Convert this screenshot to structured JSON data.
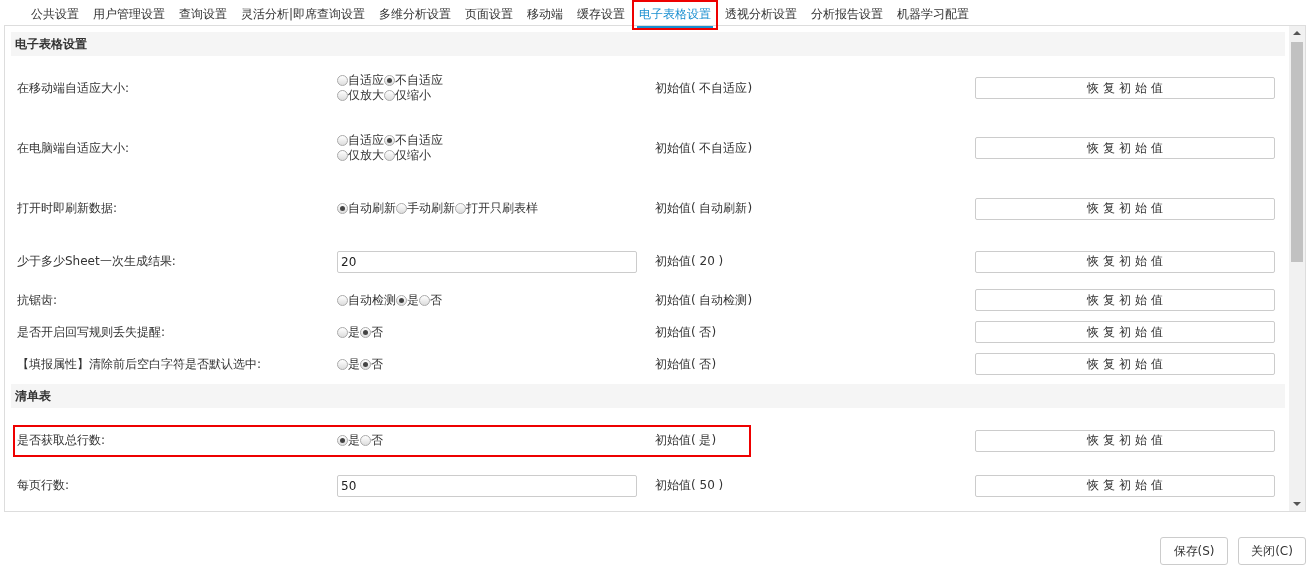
{
  "tabs": [
    {
      "label": "公共设置",
      "selected": false,
      "highlighted": false
    },
    {
      "label": "用户管理设置",
      "selected": false,
      "highlighted": false
    },
    {
      "label": "查询设置",
      "selected": false,
      "highlighted": false
    },
    {
      "label": "灵活分析|即席查询设置",
      "selected": false,
      "highlighted": false
    },
    {
      "label": "多维分析设置",
      "selected": false,
      "highlighted": false
    },
    {
      "label": "页面设置",
      "selected": false,
      "highlighted": false
    },
    {
      "label": "移动端",
      "selected": false,
      "highlighted": false
    },
    {
      "label": "缓存设置",
      "selected": false,
      "highlighted": false
    },
    {
      "label": "电子表格设置",
      "selected": true,
      "highlighted": true
    },
    {
      "label": "透视分析设置",
      "selected": false,
      "highlighted": false
    },
    {
      "label": "分析报告设置",
      "selected": false,
      "highlighted": false
    },
    {
      "label": "机器学习配置",
      "selected": false,
      "highlighted": false
    }
  ],
  "sections": [
    {
      "title": "电子表格设置",
      "rows": [
        {
          "label": "在移动端自适应大小:",
          "kind": "radio",
          "highlighted": false,
          "option_lines": [
            [
              {
                "label": "自适应",
                "selected": false
              },
              {
                "label": "不自适应",
                "selected": true
              }
            ],
            [
              {
                "label": "仅放大",
                "selected": false
              },
              {
                "label": "仅缩小",
                "selected": false
              }
            ]
          ],
          "initial": "初始值( 不自适应)",
          "button": "恢 复 初 始 值"
        },
        {
          "label": "在电脑端自适应大小:",
          "kind": "radio",
          "highlighted": false,
          "option_lines": [
            [
              {
                "label": "自适应",
                "selected": false
              },
              {
                "label": "不自适应",
                "selected": true
              }
            ],
            [
              {
                "label": "仅放大",
                "selected": false
              },
              {
                "label": "仅缩小",
                "selected": false
              }
            ]
          ],
          "initial": "初始值( 不自适应)",
          "button": "恢 复 初 始 值"
        },
        {
          "label": "打开时即刷新数据:",
          "kind": "radio",
          "highlighted": false,
          "option_lines": [
            [
              {
                "label": "自动刷新",
                "selected": true
              },
              {
                "label": "手动刷新",
                "selected": false
              },
              {
                "label": "打开只刷表样",
                "selected": false
              }
            ]
          ],
          "initial": "初始值( 自动刷新)",
          "button": "恢 复 初 始 值"
        },
        {
          "label": "少于多少Sheet一次生成结果:",
          "kind": "input",
          "highlighted": false,
          "value": "20",
          "initial": "初始值( 20 )",
          "button": "恢 复 初 始 值"
        },
        {
          "label": "抗锯齿:",
          "kind": "radio",
          "highlighted": false,
          "option_lines": [
            [
              {
                "label": "自动检测",
                "selected": false
              },
              {
                "label": "是",
                "selected": true
              },
              {
                "label": "否",
                "selected": false
              }
            ]
          ],
          "initial": "初始值( 自动检测)",
          "button": "恢 复 初 始 值"
        },
        {
          "label": "是否开启回写规则丢失提醒:",
          "kind": "radio",
          "highlighted": false,
          "option_lines": [
            [
              {
                "label": "是",
                "selected": false
              },
              {
                "label": "否",
                "selected": true
              }
            ]
          ],
          "initial": "初始值( 否)",
          "button": "恢 复 初 始 值"
        },
        {
          "label": "【填报属性】清除前后空白字符是否默认选中:",
          "kind": "radio",
          "highlighted": false,
          "option_lines": [
            [
              {
                "label": "是",
                "selected": false
              },
              {
                "label": "否",
                "selected": true
              }
            ]
          ],
          "initial": "初始值( 否)",
          "button": "恢 复 初 始 值"
        }
      ]
    },
    {
      "title": "清单表",
      "rows": [
        {
          "label": "是否获取总行数:",
          "kind": "radio",
          "highlighted": true,
          "option_lines": [
            [
              {
                "label": "是",
                "selected": true
              },
              {
                "label": "否",
                "selected": false
              }
            ]
          ],
          "initial": "初始值( 是)",
          "button": "恢 复 初 始 值"
        },
        {
          "label": "每页行数:",
          "kind": "input",
          "highlighted": false,
          "value": "50",
          "initial": "初始值( 50 )",
          "button": "恢 复 初 始 值"
        }
      ]
    }
  ],
  "footer_buttons": [
    "保存(S)",
    "关闭(C)"
  ]
}
